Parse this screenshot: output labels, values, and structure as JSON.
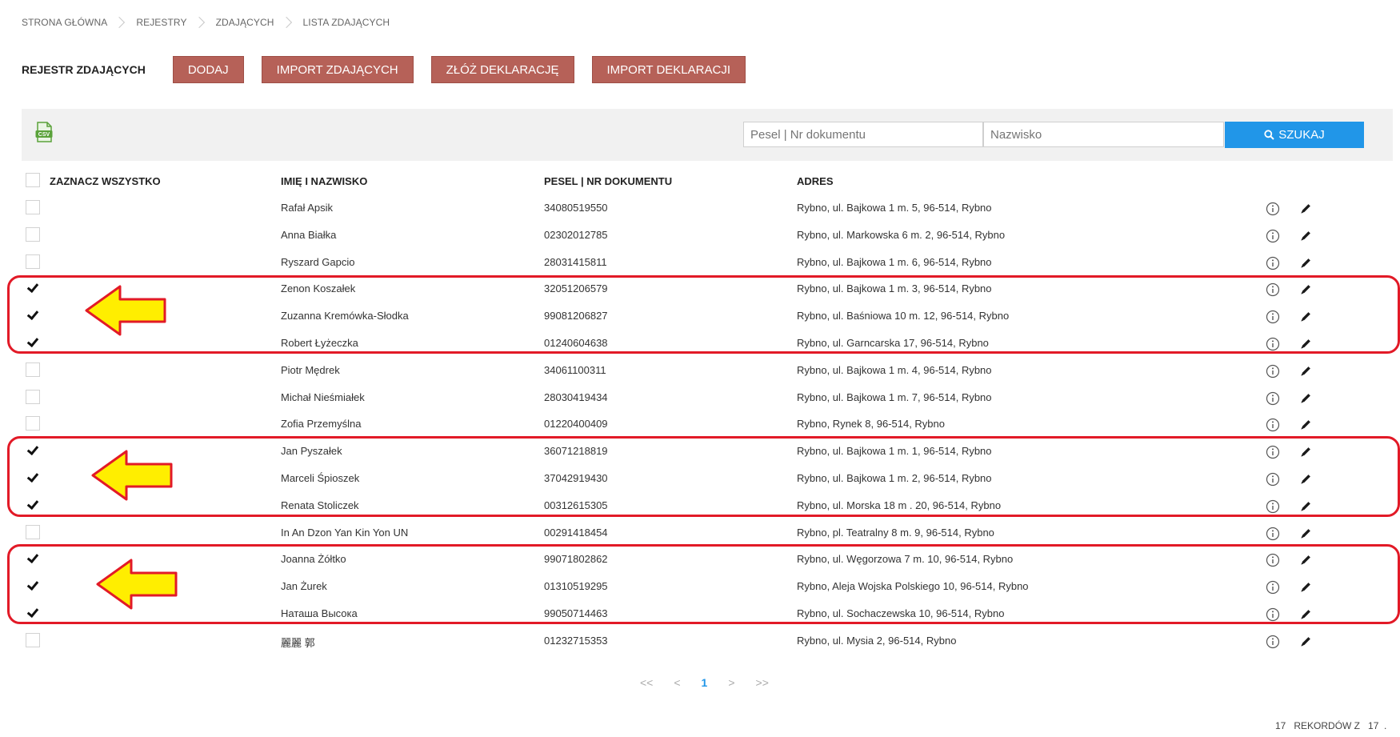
{
  "breadcrumb": [
    "STRONA GŁÓWNA",
    "REJESTRY",
    "ZDAJĄCYCH",
    "LISTA ZDAJĄCYCH"
  ],
  "page_title": "REJESTR ZDAJĄCYCH",
  "toolbar": {
    "add": "DODAJ",
    "import_candidates": "IMPORT ZDAJĄCYCH",
    "submit_declaration": "ZŁÓŻ DEKLARACJĘ",
    "import_declarations": "IMPORT DEKLARACJI"
  },
  "filters": {
    "pesel_placeholder": "Pesel | Nr dokumentu",
    "surname_placeholder": "Nazwisko",
    "search_label": "SZUKAJ"
  },
  "table": {
    "select_all": "ZAZNACZ WSZYSTKO",
    "headers": {
      "name": "IMIĘ I NAZWISKO",
      "pesel": "PESEL | NR DOKUMENTU",
      "address": "ADRES"
    },
    "rows": [
      {
        "checked": false,
        "name": "Rafał Apsik",
        "pesel": "34080519550",
        "address": "Rybno, ul. Bajkowa 1 m. 5, 96-514, Rybno"
      },
      {
        "checked": false,
        "name": "Anna Białka",
        "pesel": "02302012785",
        "address": "Rybno, ul. Markowska 6 m. 2, 96-514, Rybno"
      },
      {
        "checked": false,
        "name": "Ryszard Gapcio",
        "pesel": "28031415811",
        "address": "Rybno, ul. Bajkowa 1 m. 6, 96-514, Rybno"
      },
      {
        "checked": true,
        "name": "Zenon Koszałek",
        "pesel": "32051206579",
        "address": "Rybno, ul. Bajkowa 1 m. 3, 96-514, Rybno"
      },
      {
        "checked": true,
        "name": "Zuzanna Kremówka-Słodka",
        "pesel": "99081206827",
        "address": "Rybno, ul. Baśniowa 10 m. 12, 96-514, Rybno"
      },
      {
        "checked": true,
        "name": "Robert Łyżeczka",
        "pesel": "01240604638",
        "address": "Rybno, ul. Garncarska 17, 96-514, Rybno"
      },
      {
        "checked": false,
        "name": "Piotr Mędrek",
        "pesel": "34061100311",
        "address": "Rybno, ul. Bajkowa 1 m. 4, 96-514, Rybno"
      },
      {
        "checked": false,
        "name": "Michał Nieśmiałek",
        "pesel": "28030419434",
        "address": "Rybno, ul. Bajkowa 1 m. 7, 96-514, Rybno"
      },
      {
        "checked": false,
        "name": "Zofia Przemyślna",
        "pesel": "01220400409",
        "address": "Rybno, Rynek 8, 96-514, Rybno"
      },
      {
        "checked": true,
        "name": "Jan Pyszałek",
        "pesel": "36071218819",
        "address": "Rybno, ul. Bajkowa 1 m. 1, 96-514, Rybno"
      },
      {
        "checked": true,
        "name": "Marceli Śpioszek",
        "pesel": "37042919430",
        "address": "Rybno, ul. Bajkowa 1 m. 2, 96-514, Rybno"
      },
      {
        "checked": true,
        "name": "Renata Stoliczek",
        "pesel": "00312615305",
        "address": "Rybno, ul. Morska 18 m . 20, 96-514, Rybno"
      },
      {
        "checked": false,
        "name": "In An Dzon Yan Kin Yon UN",
        "pesel": "00291418454",
        "address": "Rybno, pl. Teatralny 8 m. 9, 96-514, Rybno"
      },
      {
        "checked": true,
        "name": "Joanna Żółtko",
        "pesel": "99071802862",
        "address": "Rybno, ul. Węgorzowa 7 m. 10, 96-514, Rybno"
      },
      {
        "checked": true,
        "name": "Jan Żurek",
        "pesel": "01310519295",
        "address": "Rybno, Aleja Wojska Polskiego 10, 96-514, Rybno"
      },
      {
        "checked": true,
        "name": "Наташа Высока",
        "pesel": "99050714463",
        "address": "Rybno, ul. Sochaczewska 10, 96-514, Rybno"
      },
      {
        "checked": false,
        "name": "麗麗 郭",
        "pesel": "01232715353",
        "address": "Rybno, ul. Mysia 2, 96-514, Rybno"
      }
    ]
  },
  "pagination": {
    "first": "<<",
    "prev": "<",
    "current": "1",
    "next": ">",
    "last": ">>"
  },
  "records": "17   REKORDÓW Z   17  .",
  "colors": {
    "action_button": "#b66158",
    "search_button": "#2196e8",
    "highlight": "#e21a27",
    "arrow_fill": "#ffee00"
  }
}
